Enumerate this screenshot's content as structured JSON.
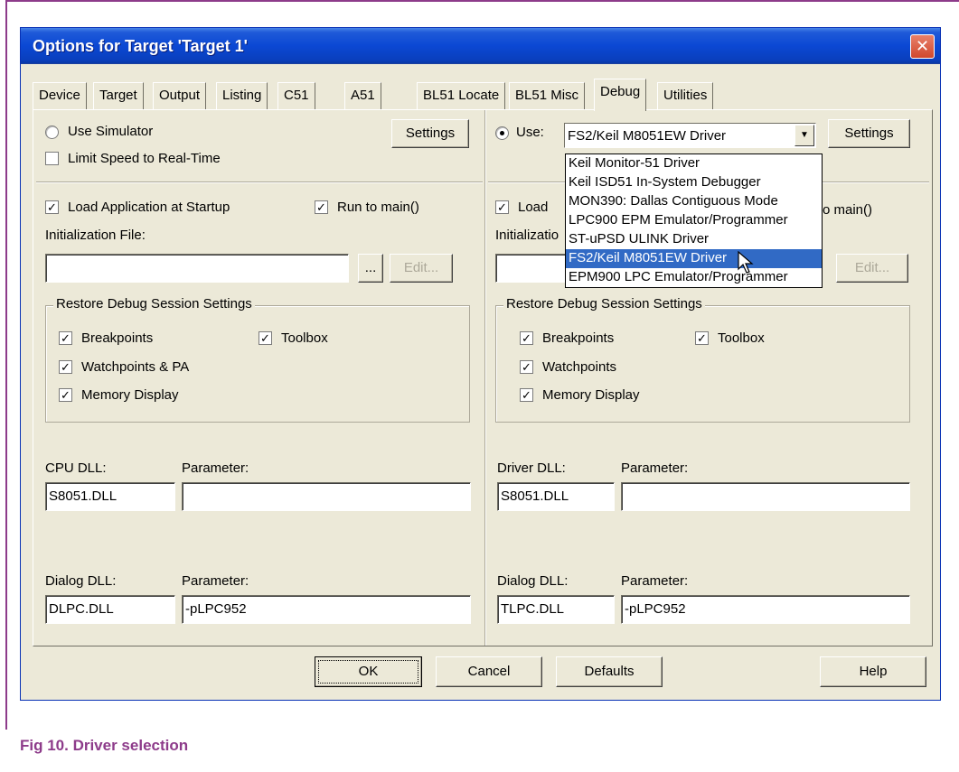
{
  "window": {
    "title": "Options for Target 'Target 1'"
  },
  "tabs": [
    {
      "label": "Device"
    },
    {
      "label": "Target"
    },
    {
      "label": "Output"
    },
    {
      "label": "Listing"
    },
    {
      "label": "C51"
    },
    {
      "label": "A51"
    },
    {
      "label": "BL51 Locate"
    },
    {
      "label": "BL51 Misc"
    },
    {
      "label": "Debug"
    },
    {
      "label": "Utilities"
    }
  ],
  "active_tab": "Debug",
  "left": {
    "use_simulator_label": "Use Simulator",
    "use_simulator_selected": false,
    "settings_label": "Settings",
    "limit_speed_label": "Limit Speed to Real-Time",
    "limit_speed_checked": false,
    "load_app_label": "Load Application at Startup",
    "load_app_checked": true,
    "run_to_main_label": "Run to main()",
    "run_to_main_checked": true,
    "init_file_label": "Initialization File:",
    "init_file_value": "",
    "browse_label": "...",
    "edit_label": "Edit...",
    "restore_group_label": "Restore Debug Session Settings",
    "breakpoints_label": "Breakpoints",
    "toolbox_label": "Toolbox",
    "watchpoints_label": "Watchpoints & PA",
    "memory_display_label": "Memory Display",
    "cpu_dll_label": "CPU DLL:",
    "cpu_dll_value": "S8051.DLL",
    "cpu_param_label": "Parameter:",
    "cpu_param_value": "",
    "dialog_dll_label": "Dialog DLL:",
    "dialog_dll_value": "DLPC.DLL",
    "dialog_param_label": "Parameter:",
    "dialog_param_value": "-pLPC952"
  },
  "right": {
    "use_label": "Use:",
    "use_selected": true,
    "driver_selected": "FS2/Keil M8051EW Driver",
    "settings_label": "Settings",
    "load_label_visible": "Load",
    "run_to_main_visible": "o main()",
    "init_label_visible": "Initializatio",
    "edit_label": "Edit...",
    "restore_group_label": "Restore Debug Session Settings",
    "breakpoints_label": "Breakpoints",
    "toolbox_label": "Toolbox",
    "watchpoints_label": "Watchpoints",
    "memory_display_label": "Memory Display",
    "driver_dll_label": "Driver DLL:",
    "driver_dll_value": "S8051.DLL",
    "driver_param_label": "Parameter:",
    "driver_param_value": "",
    "dialog_dll_label": "Dialog DLL:",
    "dialog_dll_value": "TLPC.DLL",
    "dialog_param_label": "Parameter:",
    "dialog_param_value": "-pLPC952"
  },
  "dropdown_options": [
    "Keil Monitor-51 Driver",
    "Keil ISD51 In-System Debugger",
    "MON390: Dallas Contiguous Mode",
    "LPC900 EPM Emulator/Programmer",
    "ST-uPSD ULINK Driver",
    "FS2/Keil M8051EW Driver",
    "EPM900 LPC Emulator/Programmer"
  ],
  "dropdown_highlighted": "FS2/Keil M8051EW Driver",
  "footer": {
    "ok": "OK",
    "cancel": "Cancel",
    "defaults": "Defaults",
    "help": "Help"
  },
  "caption": "Fig 10.  Driver selection",
  "colors": {
    "caption": "#8d3b8a",
    "titlebar": "#0b48d4",
    "highlight": "#316ac5",
    "face": "#ece9d8"
  }
}
